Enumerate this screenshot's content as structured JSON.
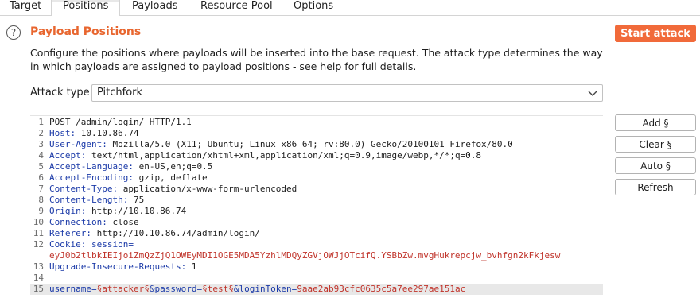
{
  "tabs": [
    {
      "label": "Target"
    },
    {
      "label": "Positions",
      "active": true
    },
    {
      "label": "Payloads"
    },
    {
      "label": "Resource Pool"
    },
    {
      "label": "Options"
    }
  ],
  "header": {
    "help_icon": "question-circle-icon",
    "help_glyph": "?",
    "title": "Payload Positions",
    "start_attack_label": "Start attack",
    "accent_color": "#e8662f"
  },
  "description": "Configure the positions where payloads will be inserted into the base request. The attack type determines the way in which payloads are assigned to payload positions - see help for full details.",
  "attack_type": {
    "label": "Attack type:",
    "selected": "Pitchfork"
  },
  "request": {
    "lines": [
      {
        "n": "1",
        "parts": [
          {
            "t": "POST /admin/login/ HTTP/1.1",
            "c": "v"
          }
        ]
      },
      {
        "n": "2",
        "parts": [
          {
            "t": "Host:",
            "c": "k"
          },
          {
            "t": " 10.10.86.74",
            "c": "v"
          }
        ]
      },
      {
        "n": "3",
        "parts": [
          {
            "t": "User-Agent:",
            "c": "k"
          },
          {
            "t": " Mozilla/5.0 (X11; Ubuntu; Linux x86_64; rv:80.0) Gecko/20100101 Firefox/80.0",
            "c": "v"
          }
        ]
      },
      {
        "n": "4",
        "parts": [
          {
            "t": "Accept:",
            "c": "k"
          },
          {
            "t": " text/html,application/xhtml+xml,application/xml;q=0.9,image/webp,*/*;q=0.8",
            "c": "v"
          }
        ]
      },
      {
        "n": "5",
        "parts": [
          {
            "t": "Accept-Language:",
            "c": "k"
          },
          {
            "t": " en-US,en;q=0.5",
            "c": "v"
          }
        ]
      },
      {
        "n": "6",
        "parts": [
          {
            "t": "Accept-Encoding:",
            "c": "k"
          },
          {
            "t": " gzip, deflate",
            "c": "v"
          }
        ]
      },
      {
        "n": "7",
        "parts": [
          {
            "t": "Content-Type:",
            "c": "k"
          },
          {
            "t": " application/x-www-form-urlencoded",
            "c": "v"
          }
        ]
      },
      {
        "n": "8",
        "parts": [
          {
            "t": "Content-Length:",
            "c": "k"
          },
          {
            "t": " 75",
            "c": "v"
          }
        ]
      },
      {
        "n": "9",
        "parts": [
          {
            "t": "Origin:",
            "c": "k"
          },
          {
            "t": " http://10.10.86.74",
            "c": "v"
          }
        ]
      },
      {
        "n": "10",
        "parts": [
          {
            "t": "Connection:",
            "c": "k"
          },
          {
            "t": " close",
            "c": "v"
          }
        ]
      },
      {
        "n": "11",
        "parts": [
          {
            "t": "Referer:",
            "c": "k"
          },
          {
            "t": " http://10.10.86.74/admin/login/",
            "c": "v"
          }
        ]
      },
      {
        "n": "12",
        "parts": [
          {
            "t": "Cookie:",
            "c": "k"
          },
          {
            "t": " session=",
            "c": "k"
          }
        ]
      },
      {
        "n": "",
        "parts": [
          {
            "t": "eyJ0b2tlbkIEIjoiZmQzZjQ1OWEyMDI1OGE5MDA5YzhlMDQyZGVjOWJjOTcifQ.YSBbZw.mvgHukrepcjw_bvhfgn2kFkjesw",
            "c": "s"
          }
        ]
      },
      {
        "n": "13",
        "parts": [
          {
            "t": "Upgrade-Insecure-Requests:",
            "c": "k"
          },
          {
            "t": " 1",
            "c": "v"
          }
        ]
      },
      {
        "n": "14",
        "parts": []
      },
      {
        "n": "15",
        "highlight": true,
        "parts": [
          {
            "t": "username=",
            "c": "k"
          },
          {
            "t": "§attacker§",
            "c": "s"
          },
          {
            "t": "&password=",
            "c": "k"
          },
          {
            "t": "§test§",
            "c": "s"
          },
          {
            "t": "&loginToken=",
            "c": "k"
          },
          {
            "t": "9aae2ab93cfc0635c5a7ee297ae151ac",
            "c": "s"
          }
        ]
      }
    ]
  },
  "side_buttons": [
    {
      "name": "add-position-button",
      "label": "Add §"
    },
    {
      "name": "clear-positions-button",
      "label": "Clear §"
    },
    {
      "name": "auto-positions-button",
      "label": "Auto §"
    },
    {
      "name": "refresh-button",
      "label": "Refresh"
    }
  ]
}
